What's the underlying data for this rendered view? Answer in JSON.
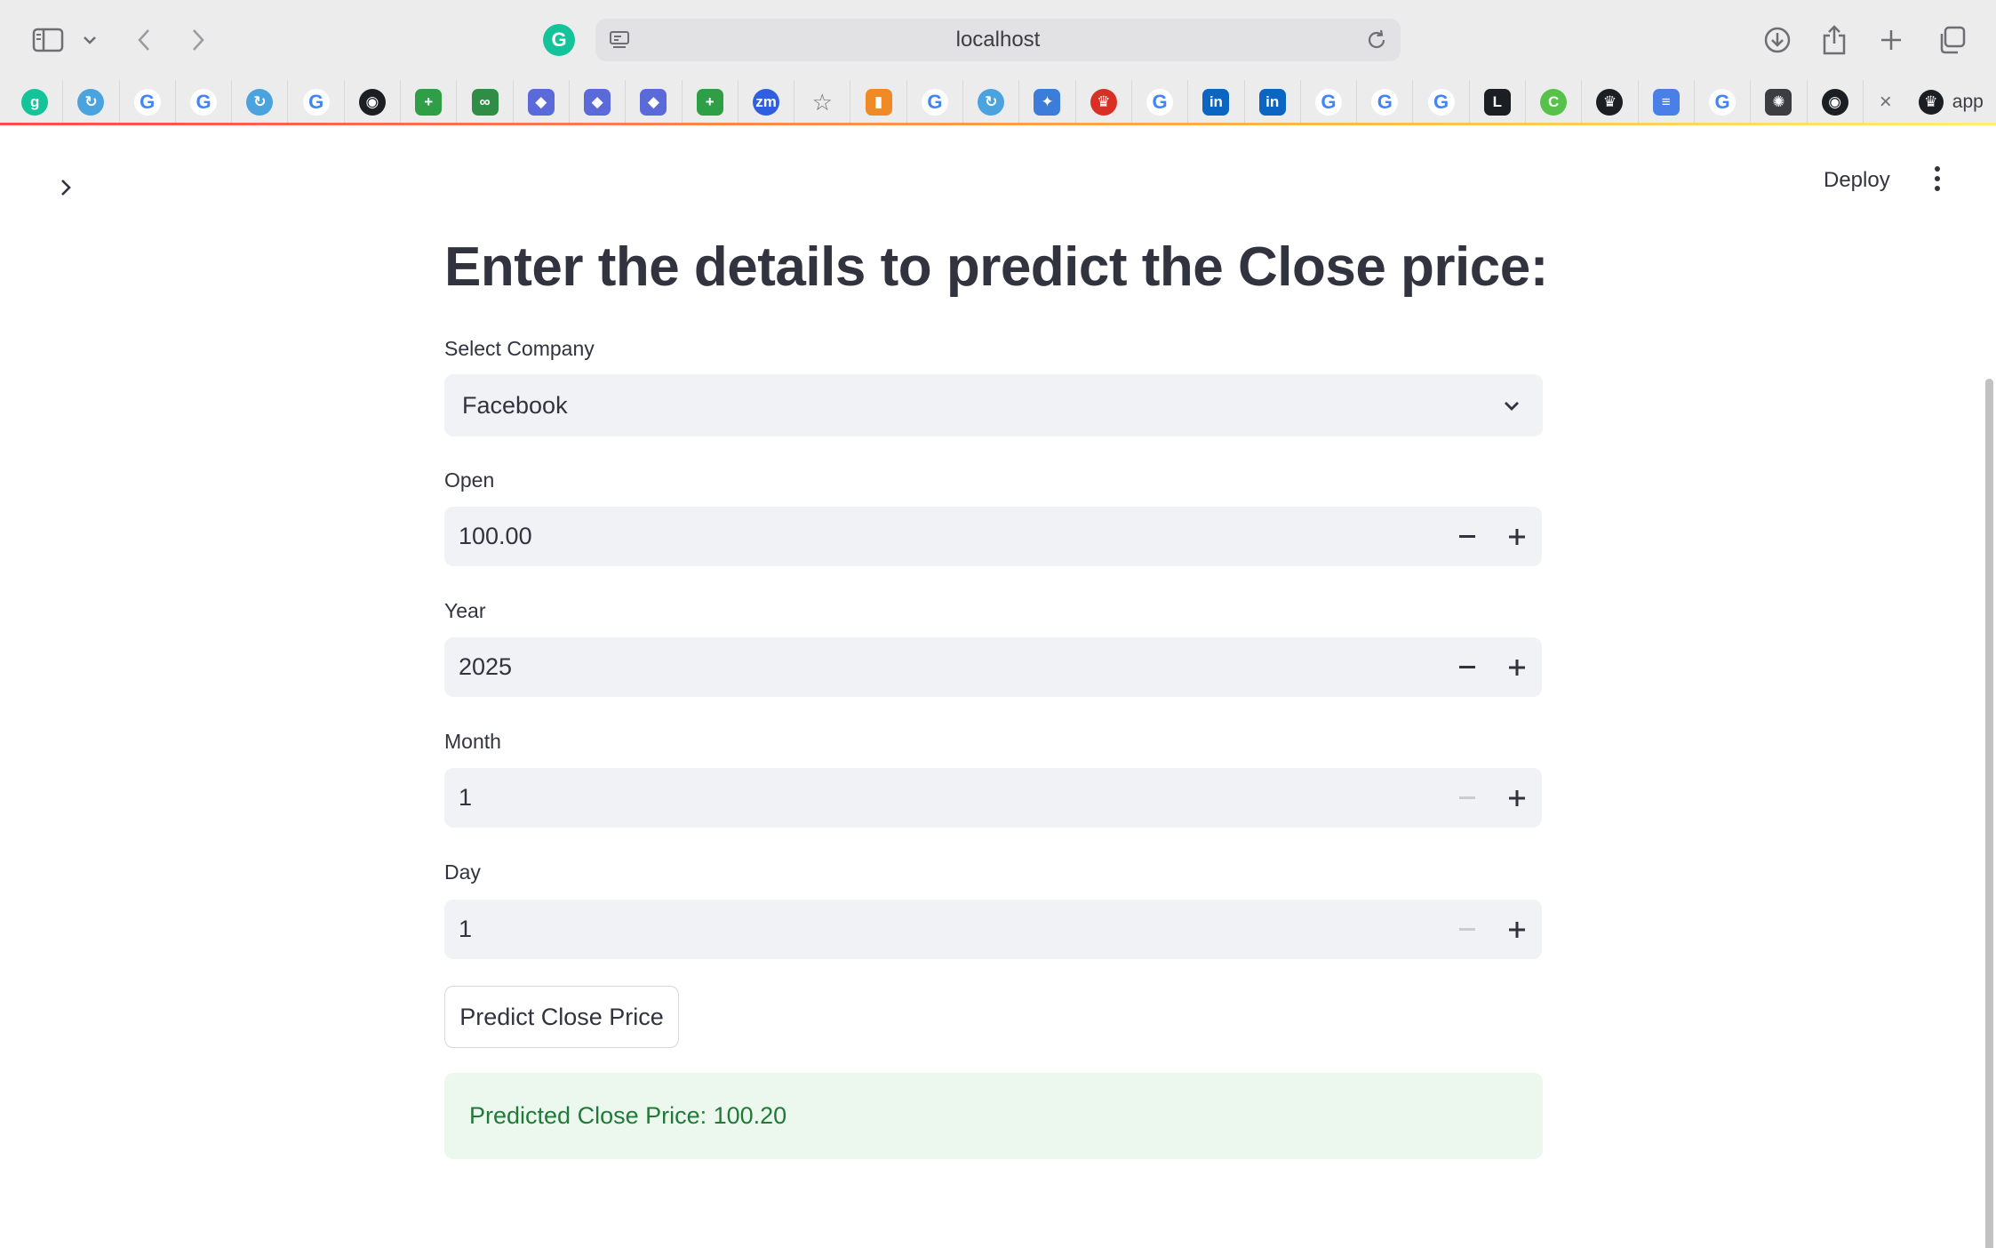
{
  "browser": {
    "address": "localhost",
    "bookmarks": [
      {
        "icon": "grammarly-favicon",
        "glyph": "g",
        "color": "#15c39a"
      },
      {
        "icon": "refresh-app-favicon",
        "glyph": "↻",
        "color": "#4aa3df"
      },
      {
        "icon": "google-favicon",
        "glyph": "G",
        "color": "#4285f4"
      },
      {
        "icon": "google-favicon",
        "glyph": "G",
        "color": "#4285f4"
      },
      {
        "icon": "refresh-app-favicon",
        "glyph": "↻",
        "color": "#4aa3df"
      },
      {
        "icon": "google-favicon",
        "glyph": "G",
        "color": "#4285f4"
      },
      {
        "icon": "github-favicon",
        "glyph": "◉",
        "color": "#1b1f23"
      },
      {
        "icon": "plus-sheet-favicon",
        "glyph": "+",
        "color": "#2e9e47"
      },
      {
        "icon": "geeksforgeeks-favicon",
        "glyph": "∞",
        "color": "#2f8d46"
      },
      {
        "icon": "docker-favicon",
        "glyph": "◆",
        "color": "#5a6ad8"
      },
      {
        "icon": "docker-favicon",
        "glyph": "◆",
        "color": "#5a6ad8"
      },
      {
        "icon": "docker-favicon",
        "glyph": "◆",
        "color": "#5a6ad8"
      },
      {
        "icon": "plus-sheet-favicon",
        "glyph": "+",
        "color": "#2e9e47"
      },
      {
        "icon": "zoom-favicon",
        "glyph": "zm",
        "color": "#2d5fe0"
      },
      {
        "icon": "star-favicon",
        "glyph": "☆",
        "color": "#6e6e73"
      },
      {
        "icon": "analytics-favicon",
        "glyph": "▮",
        "color": "#f08a24"
      },
      {
        "icon": "google-favicon",
        "glyph": "G",
        "color": "#4285f4"
      },
      {
        "icon": "refresh-app-favicon",
        "glyph": "↻",
        "color": "#4aa3df"
      },
      {
        "icon": "chart-favicon",
        "glyph": "✦",
        "color": "#3b7dd8"
      },
      {
        "icon": "crown-favicon",
        "glyph": "♛",
        "color": "#d93025"
      },
      {
        "icon": "google-favicon",
        "glyph": "G",
        "color": "#4285f4"
      },
      {
        "icon": "linkedin-favicon",
        "glyph": "in",
        "color": "#0a66c2"
      },
      {
        "icon": "linkedin-favicon",
        "glyph": "in",
        "color": "#0a66c2"
      },
      {
        "icon": "google-favicon",
        "glyph": "G",
        "color": "#4285f4"
      },
      {
        "icon": "google-favicon",
        "glyph": "G",
        "color": "#4285f4"
      },
      {
        "icon": "google-favicon",
        "glyph": "G",
        "color": "#4285f4"
      },
      {
        "icon": "letter-l-favicon",
        "glyph": "L",
        "color": "#1b1f23"
      },
      {
        "icon": "c-circle-favicon",
        "glyph": "C",
        "color": "#57c24a"
      },
      {
        "icon": "crown-dark-favicon",
        "glyph": "♛",
        "color": "#1b1f23"
      },
      {
        "icon": "docs-favicon",
        "glyph": "≡",
        "color": "#4a7fe8"
      },
      {
        "icon": "google-favicon",
        "glyph": "G",
        "color": "#4285f4"
      },
      {
        "icon": "openai-favicon",
        "glyph": "✺",
        "color": "#3c3c43"
      },
      {
        "icon": "github-favicon",
        "glyph": "◉",
        "color": "#1b1f23"
      }
    ],
    "active_tab_label": "app"
  },
  "header": {
    "deploy_label": "Deploy"
  },
  "form": {
    "title": "Enter the details to predict the Close price:",
    "company": {
      "label": "Select Company",
      "value": "Facebook"
    },
    "open": {
      "label": "Open",
      "value": "100.00"
    },
    "year": {
      "label": "Year",
      "value": "2025"
    },
    "month": {
      "label": "Month",
      "value": "1"
    },
    "day": {
      "label": "Day",
      "value": "1"
    },
    "predict_label": "Predict Close Price"
  },
  "result": {
    "text": "Predicted Close Price: 100.20"
  },
  "colors": {
    "primary": "#ff4b4b",
    "input_bg": "#f0f2f6",
    "success_bg": "#ecf8ee",
    "success_text": "#1f7a3a"
  }
}
